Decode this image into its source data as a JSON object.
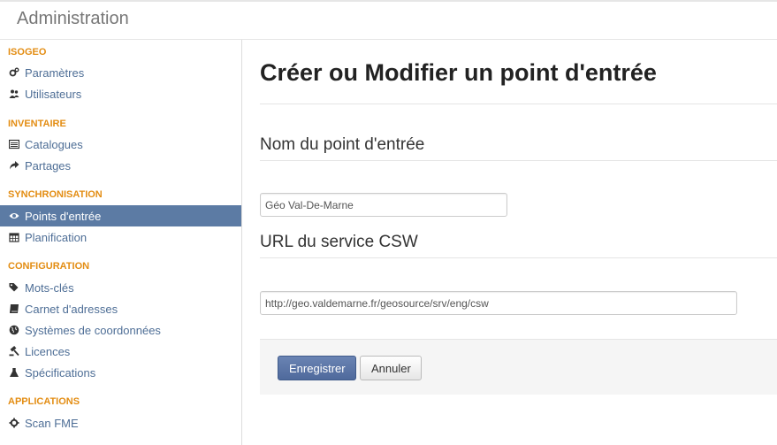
{
  "header": {
    "title": "Administration"
  },
  "sidebar": {
    "sections": [
      {
        "label": "ISOGEO",
        "items": [
          {
            "label": "Paramètres",
            "icon": "cogs-icon"
          },
          {
            "label": "Utilisateurs",
            "icon": "users-icon"
          }
        ]
      },
      {
        "label": "INVENTAIRE",
        "items": [
          {
            "label": "Catalogues",
            "icon": "list-icon"
          },
          {
            "label": "Partages",
            "icon": "share-icon"
          }
        ]
      },
      {
        "label": "SYNCHRONISATION",
        "items": [
          {
            "label": "Points d'entrée",
            "icon": "eye-icon",
            "active": true
          },
          {
            "label": "Planification",
            "icon": "calendar-icon"
          }
        ]
      },
      {
        "label": "CONFIGURATION",
        "items": [
          {
            "label": "Mots-clés",
            "icon": "tags-icon"
          },
          {
            "label": "Carnet d'adresses",
            "icon": "book-icon"
          },
          {
            "label": "Systèmes de coordonnées",
            "icon": "globe-icon"
          },
          {
            "label": "Licences",
            "icon": "gavel-icon"
          },
          {
            "label": "Spécifications",
            "icon": "flask-icon"
          }
        ]
      },
      {
        "label": "APPLICATIONS",
        "items": [
          {
            "label": "Scan FME",
            "icon": "cog-icon"
          }
        ]
      }
    ]
  },
  "main": {
    "title": "Créer ou Modifier un point d'entrée",
    "name_field": {
      "label": "Nom du point d'entrée",
      "value": "Géo Val-De-Marne"
    },
    "url_field": {
      "label": "URL du service CSW",
      "value": "http://geo.valdemarne.fr/geosource/srv/eng/csw"
    },
    "actions": {
      "save_label": "Enregistrer",
      "cancel_label": "Annuler"
    }
  },
  "colors": {
    "accent": "#e38d13",
    "active_bg": "#5c7ba4",
    "link": "#4e6e96",
    "primary_button": "#5873a6"
  }
}
